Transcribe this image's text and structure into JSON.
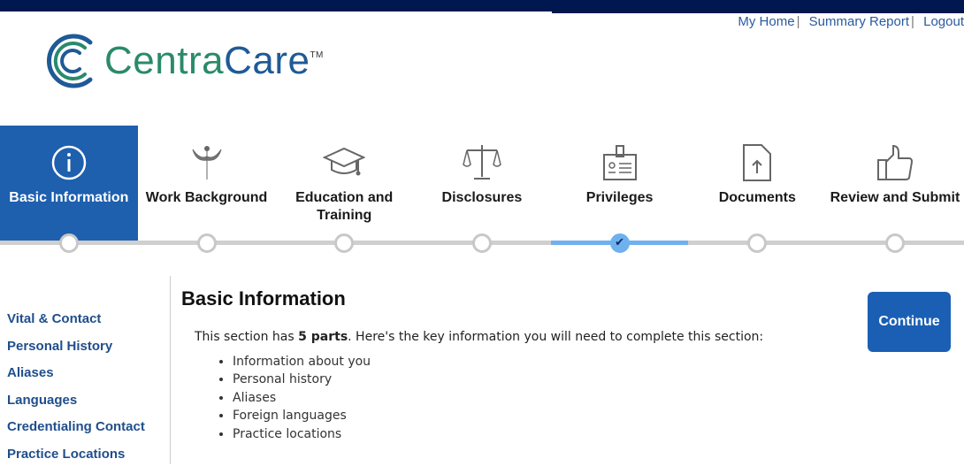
{
  "header": {
    "links": [
      "My Home",
      "Summary Report",
      "Logout"
    ],
    "logo": {
      "part1": "Centra",
      "part2": "Care",
      "tm": "TM"
    }
  },
  "steps": [
    {
      "label": "Basic Information",
      "icon": "info-icon",
      "state": "active"
    },
    {
      "label": "Work Background",
      "icon": "caduceus-icon",
      "state": "incomplete"
    },
    {
      "label": "Education and Training",
      "icon": "graduation-cap-icon",
      "state": "incomplete"
    },
    {
      "label": "Disclosures",
      "icon": "scales-icon",
      "state": "incomplete"
    },
    {
      "label": "Privileges",
      "icon": "id-badge-icon",
      "state": "complete"
    },
    {
      "label": "Documents",
      "icon": "document-upload-icon",
      "state": "incomplete"
    },
    {
      "label": "Review and Submit",
      "icon": "thumbs-up-icon",
      "state": "incomplete"
    }
  ],
  "sidebar": {
    "items": [
      "Vital & Contact",
      "Personal History",
      "Aliases",
      "Languages",
      "Credentialing Contact",
      "Practice Locations"
    ]
  },
  "main": {
    "title": "Basic Information",
    "intro_pre": "This section has ",
    "intro_bold": "5 parts",
    "intro_post": ". Here's the key information you will need to complete this section:",
    "bullets": [
      "Information about you",
      "Personal history",
      "Aliases",
      "Foreign languages",
      "Practice locations"
    ],
    "continue_label": "Continue"
  },
  "colors": {
    "topbar": "#00184f",
    "active_step": "#1e5fae",
    "continue": "#1a5fb4",
    "link": "#1f4e8c"
  }
}
